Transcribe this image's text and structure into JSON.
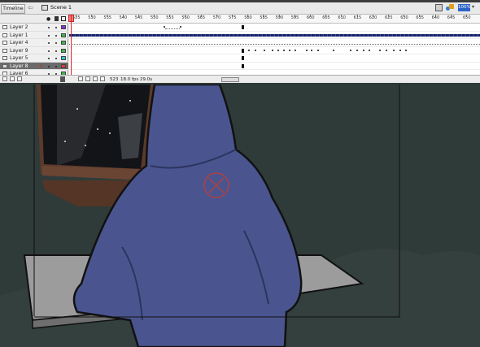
{
  "toolbar": {
    "timeline_label": "Timeline",
    "back_arrow": "⇦",
    "scene_label": "Scene 1",
    "zoom_value": "100%",
    "zoom_arrow": "▾"
  },
  "layers": [
    {
      "name": "Layer 2",
      "color": "#8a2be2",
      "selected": false
    },
    {
      "name": "Layer 1",
      "color": "#3bb84a",
      "selected": false
    },
    {
      "name": "Layer 4",
      "color": "#3bb84a",
      "selected": false
    },
    {
      "name": "Layer 9",
      "color": "#3bb84a",
      "selected": false
    },
    {
      "name": "Layer 5",
      "color": "#29c6d6",
      "selected": false
    },
    {
      "name": "Layer 8",
      "color": "#e03a3a",
      "selected": true
    },
    {
      "name": "Layer 6",
      "color": "#3bb84a",
      "selected": false
    }
  ],
  "ruler": [
    "525",
    "530",
    "535",
    "540",
    "545",
    "550",
    "555",
    "560",
    "565",
    "570",
    "575",
    "580",
    "585",
    "590",
    "595",
    "600",
    "605",
    "610",
    "615",
    "620",
    "625",
    "630",
    "635",
    "640",
    "645",
    "650"
  ],
  "status": {
    "current_frame": "523",
    "fps": "18.0 fps",
    "elapsed": "29.0s"
  },
  "colors": {
    "stage_bg": "#2e3a38",
    "hoodie": "#4a5590",
    "table": "#9a9a9a",
    "accent_red": "#e02020"
  },
  "icons": {
    "eye": "eye-icon",
    "lock": "lock-icon",
    "outline": "outline-icon",
    "trash": "trash-icon",
    "scene": "scene-icon",
    "edit_symbol": "edit-symbol-icon"
  }
}
